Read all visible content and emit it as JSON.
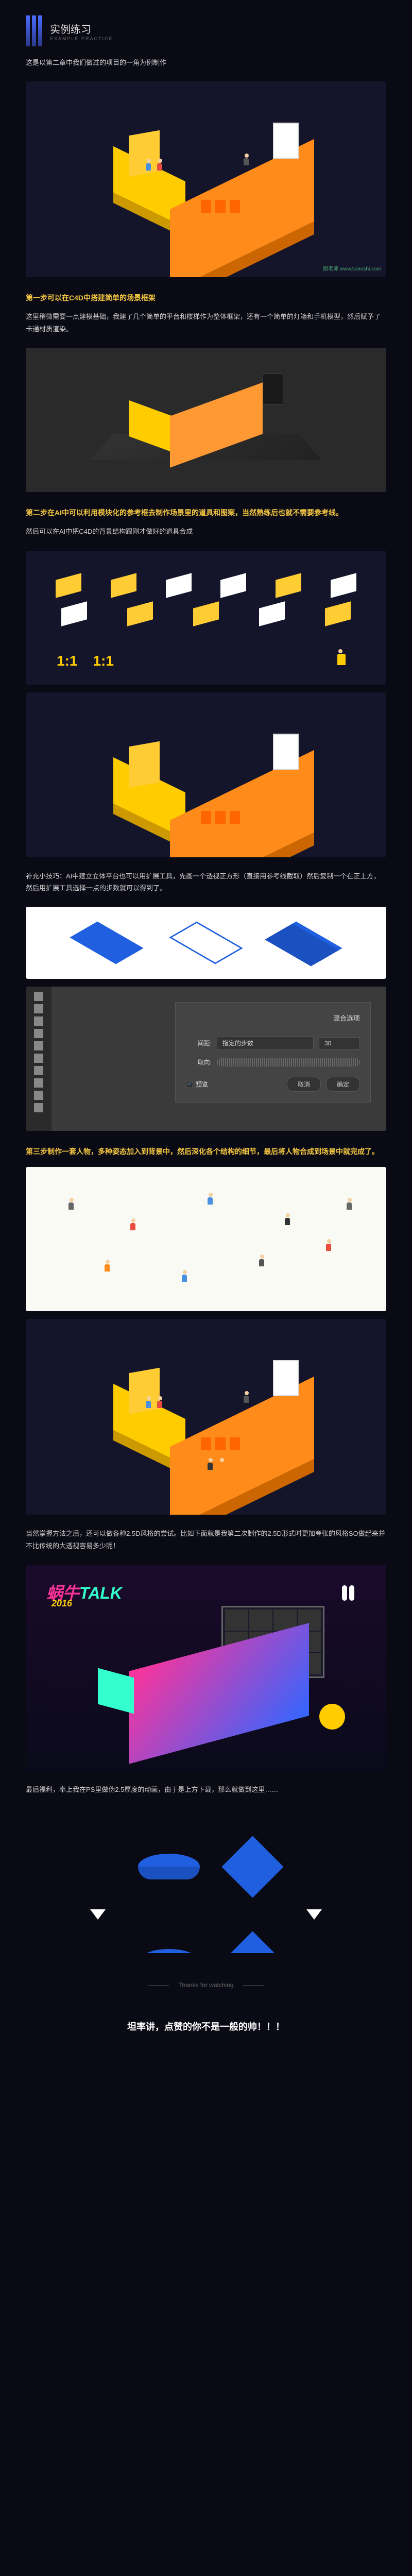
{
  "header": {
    "title": "实例练习",
    "subtitle": "EXAMPLE PRACTICE"
  },
  "intro": "这是以第二章中我们做过的项目的一角为例制作",
  "step1": {
    "title": "第一步可以在C4D中搭建简单的场景框架",
    "desc": "这里稍微需要一点建模基础，我建了几个简单的平台和楼梯作为整体框架，还有一个简单的灯箱和手机模型，然后赋予了卡通材质渲染。"
  },
  "step2": {
    "title": "第二步在AI中可以利用模块化的参考框去制作场景里的道具和图案，当然熟练后也就不需要参考线。",
    "desc": "然后可以在AI中把C4D的背景结构跟刚才做好的道具合成"
  },
  "components": {
    "ratio1": "1:1",
    "ratio2": "1:1"
  },
  "tip": {
    "desc": "补充小技巧：AI中建立立体平台也可以用扩展工具，先画一个透视正方形（直接用参考线截取）然后复制一个在正上方，然后用扩展工具选择一点的步数就可以得到了。"
  },
  "dialog": {
    "title": "混合选项",
    "spacing_label": "间距:",
    "spacing_dropdown": "指定的步数",
    "spacing_value": "30",
    "orientation_label": "取向:",
    "preview_label": "预览",
    "cancel": "取消",
    "confirm": "确定"
  },
  "step3": {
    "title": "第三步制作一套人物，多种姿态加入到背景中，然后深化各个结构的细节，最后将人物合成到场景中就完成了。"
  },
  "advanced": {
    "desc": "当然掌握方法之后，还可以做各种2.5D风格的尝试。比如下面就是我第二次制作的2.5D形式时更加夸张的风格SO做起来并不比传统的大透视容易多少呢！"
  },
  "stage": {
    "title_part1": "蜗牛",
    "title_part2": "TALK",
    "year": "2016"
  },
  "bonus": {
    "desc": "最后福利，奉上我在PS里做伪2.5厚度的动画，由于是上方下载，那么就做到这里……"
  },
  "footer": {
    "thanks": "Thanks for watching",
    "tagline": "坦率讲，点赞的你不是一般的帅！！！"
  },
  "watermark": "图老师 www.tulaoshi.com"
}
